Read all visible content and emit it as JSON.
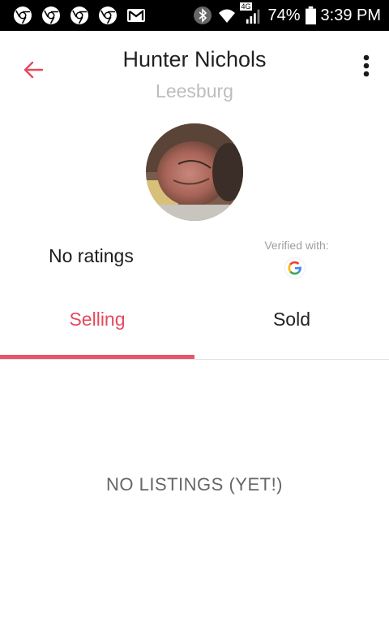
{
  "status_bar": {
    "network_type": "4G",
    "battery": "74%",
    "time": "3:39 PM"
  },
  "profile": {
    "name": "Hunter Nichols",
    "city": "Leesburg",
    "ratings": "No ratings",
    "verified_label": "Verified with:"
  },
  "tabs": [
    {
      "label": "Selling",
      "selected": true
    },
    {
      "label": "Sold",
      "selected": false
    }
  ],
  "empty_state": "NO LISTINGS (YET!)",
  "colors": {
    "accent": "#e5495d",
    "status_bar": "#000000"
  }
}
